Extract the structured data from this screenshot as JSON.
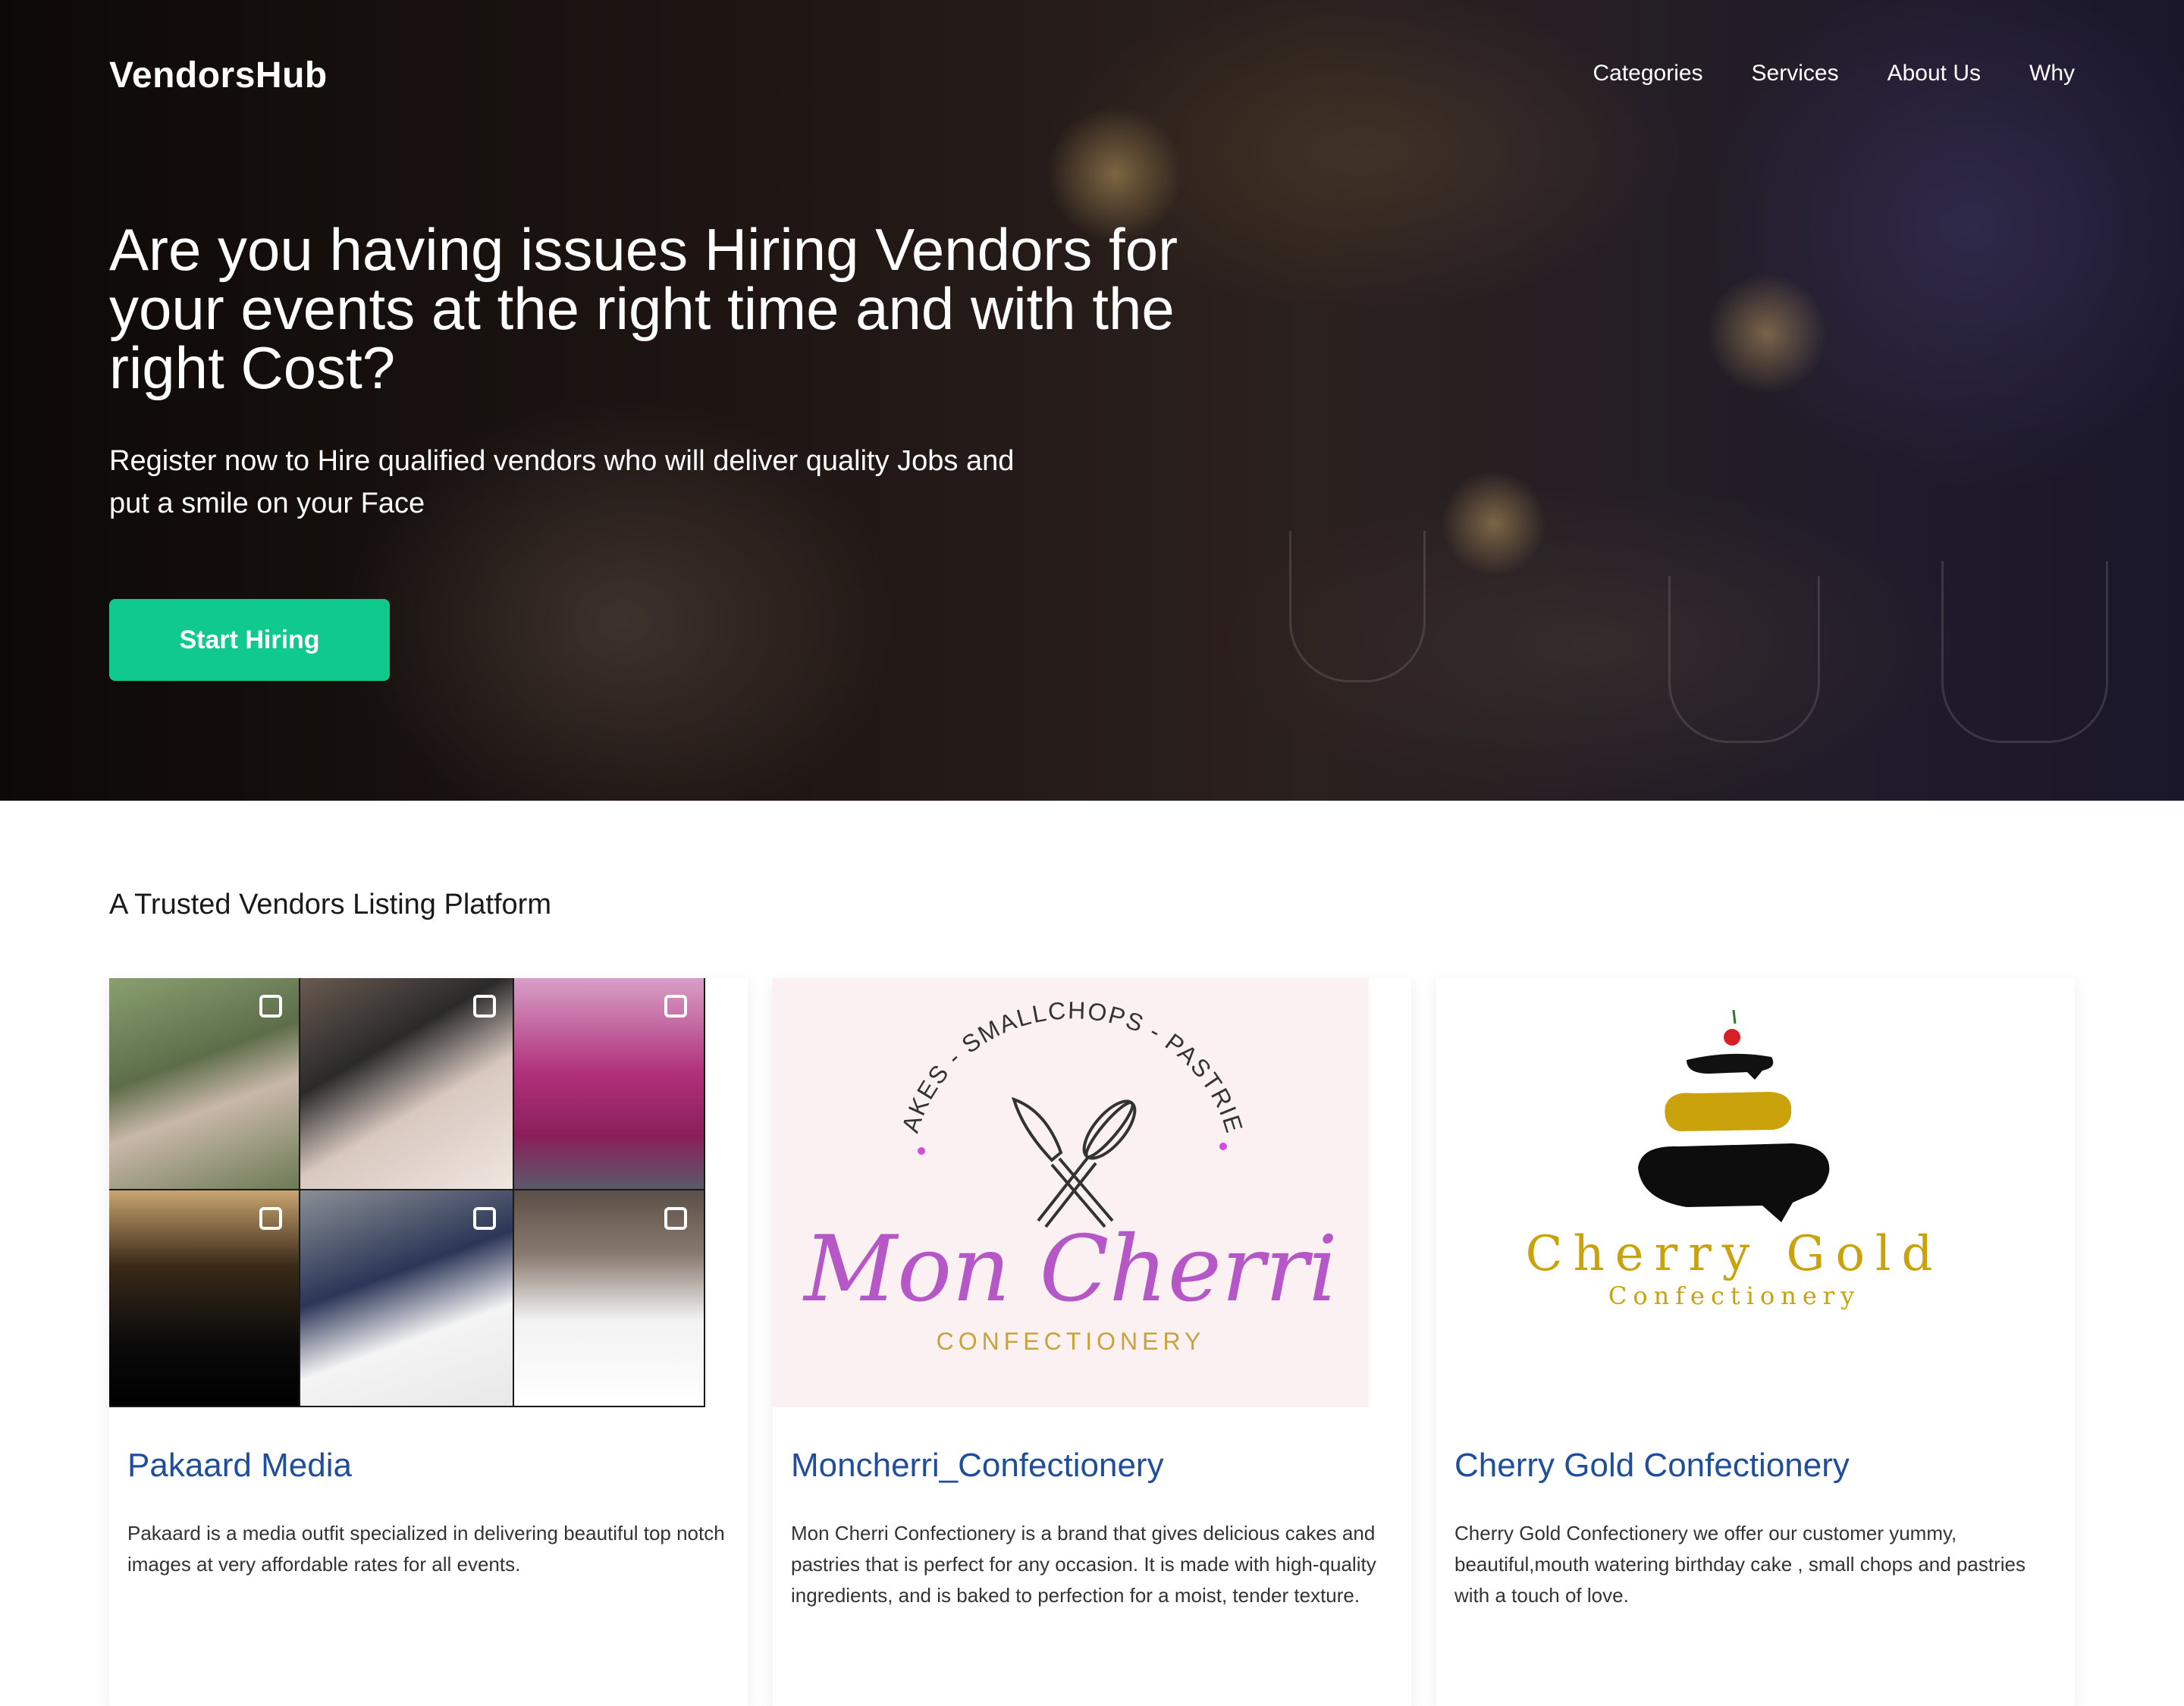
{
  "brand": "VendorsHub",
  "nav": [
    "Categories",
    "Services",
    "About Us",
    "Why"
  ],
  "hero": {
    "title": "Are you having issues Hiring Vendors for your events at the right time and with the right Cost?",
    "subtitle": "Register now to Hire qualified vendors who will deliver quality Jobs and put a smile on your Face",
    "cta": "Start Hiring"
  },
  "colors": {
    "accent": "#10c98c",
    "card_title": "#1f4e9c"
  },
  "section": {
    "title": "A Trusted Vendors Listing Platform"
  },
  "vendors": [
    {
      "name": "Pakaard Media",
      "description": "Pakaard is a media outfit specialized in delivering beautiful top notch images at very affordable rates for all events."
    },
    {
      "name": "Moncherri_Confectionery",
      "description": "Mon Cherri Confectionery is a brand that gives delicious cakes and pastries that is perfect for any occasion. It is made with high-quality ingredients, and is baked to perfection for a moist, tender texture.",
      "logo": {
        "arc_text": "CAKES - SMALLCHOPS - PASTRIES",
        "script": "Mon Cherri",
        "sub": "CONFECTIONERY"
      }
    },
    {
      "name": "Cherry Gold Confectionery",
      "description": "Cherry Gold Confectionery we offer our customer yummy, beautiful,mouth watering birthday cake , small chops and pastries with a touch of love.",
      "logo": {
        "main": "Cherry Gold",
        "sub": "Confectionery"
      }
    }
  ]
}
